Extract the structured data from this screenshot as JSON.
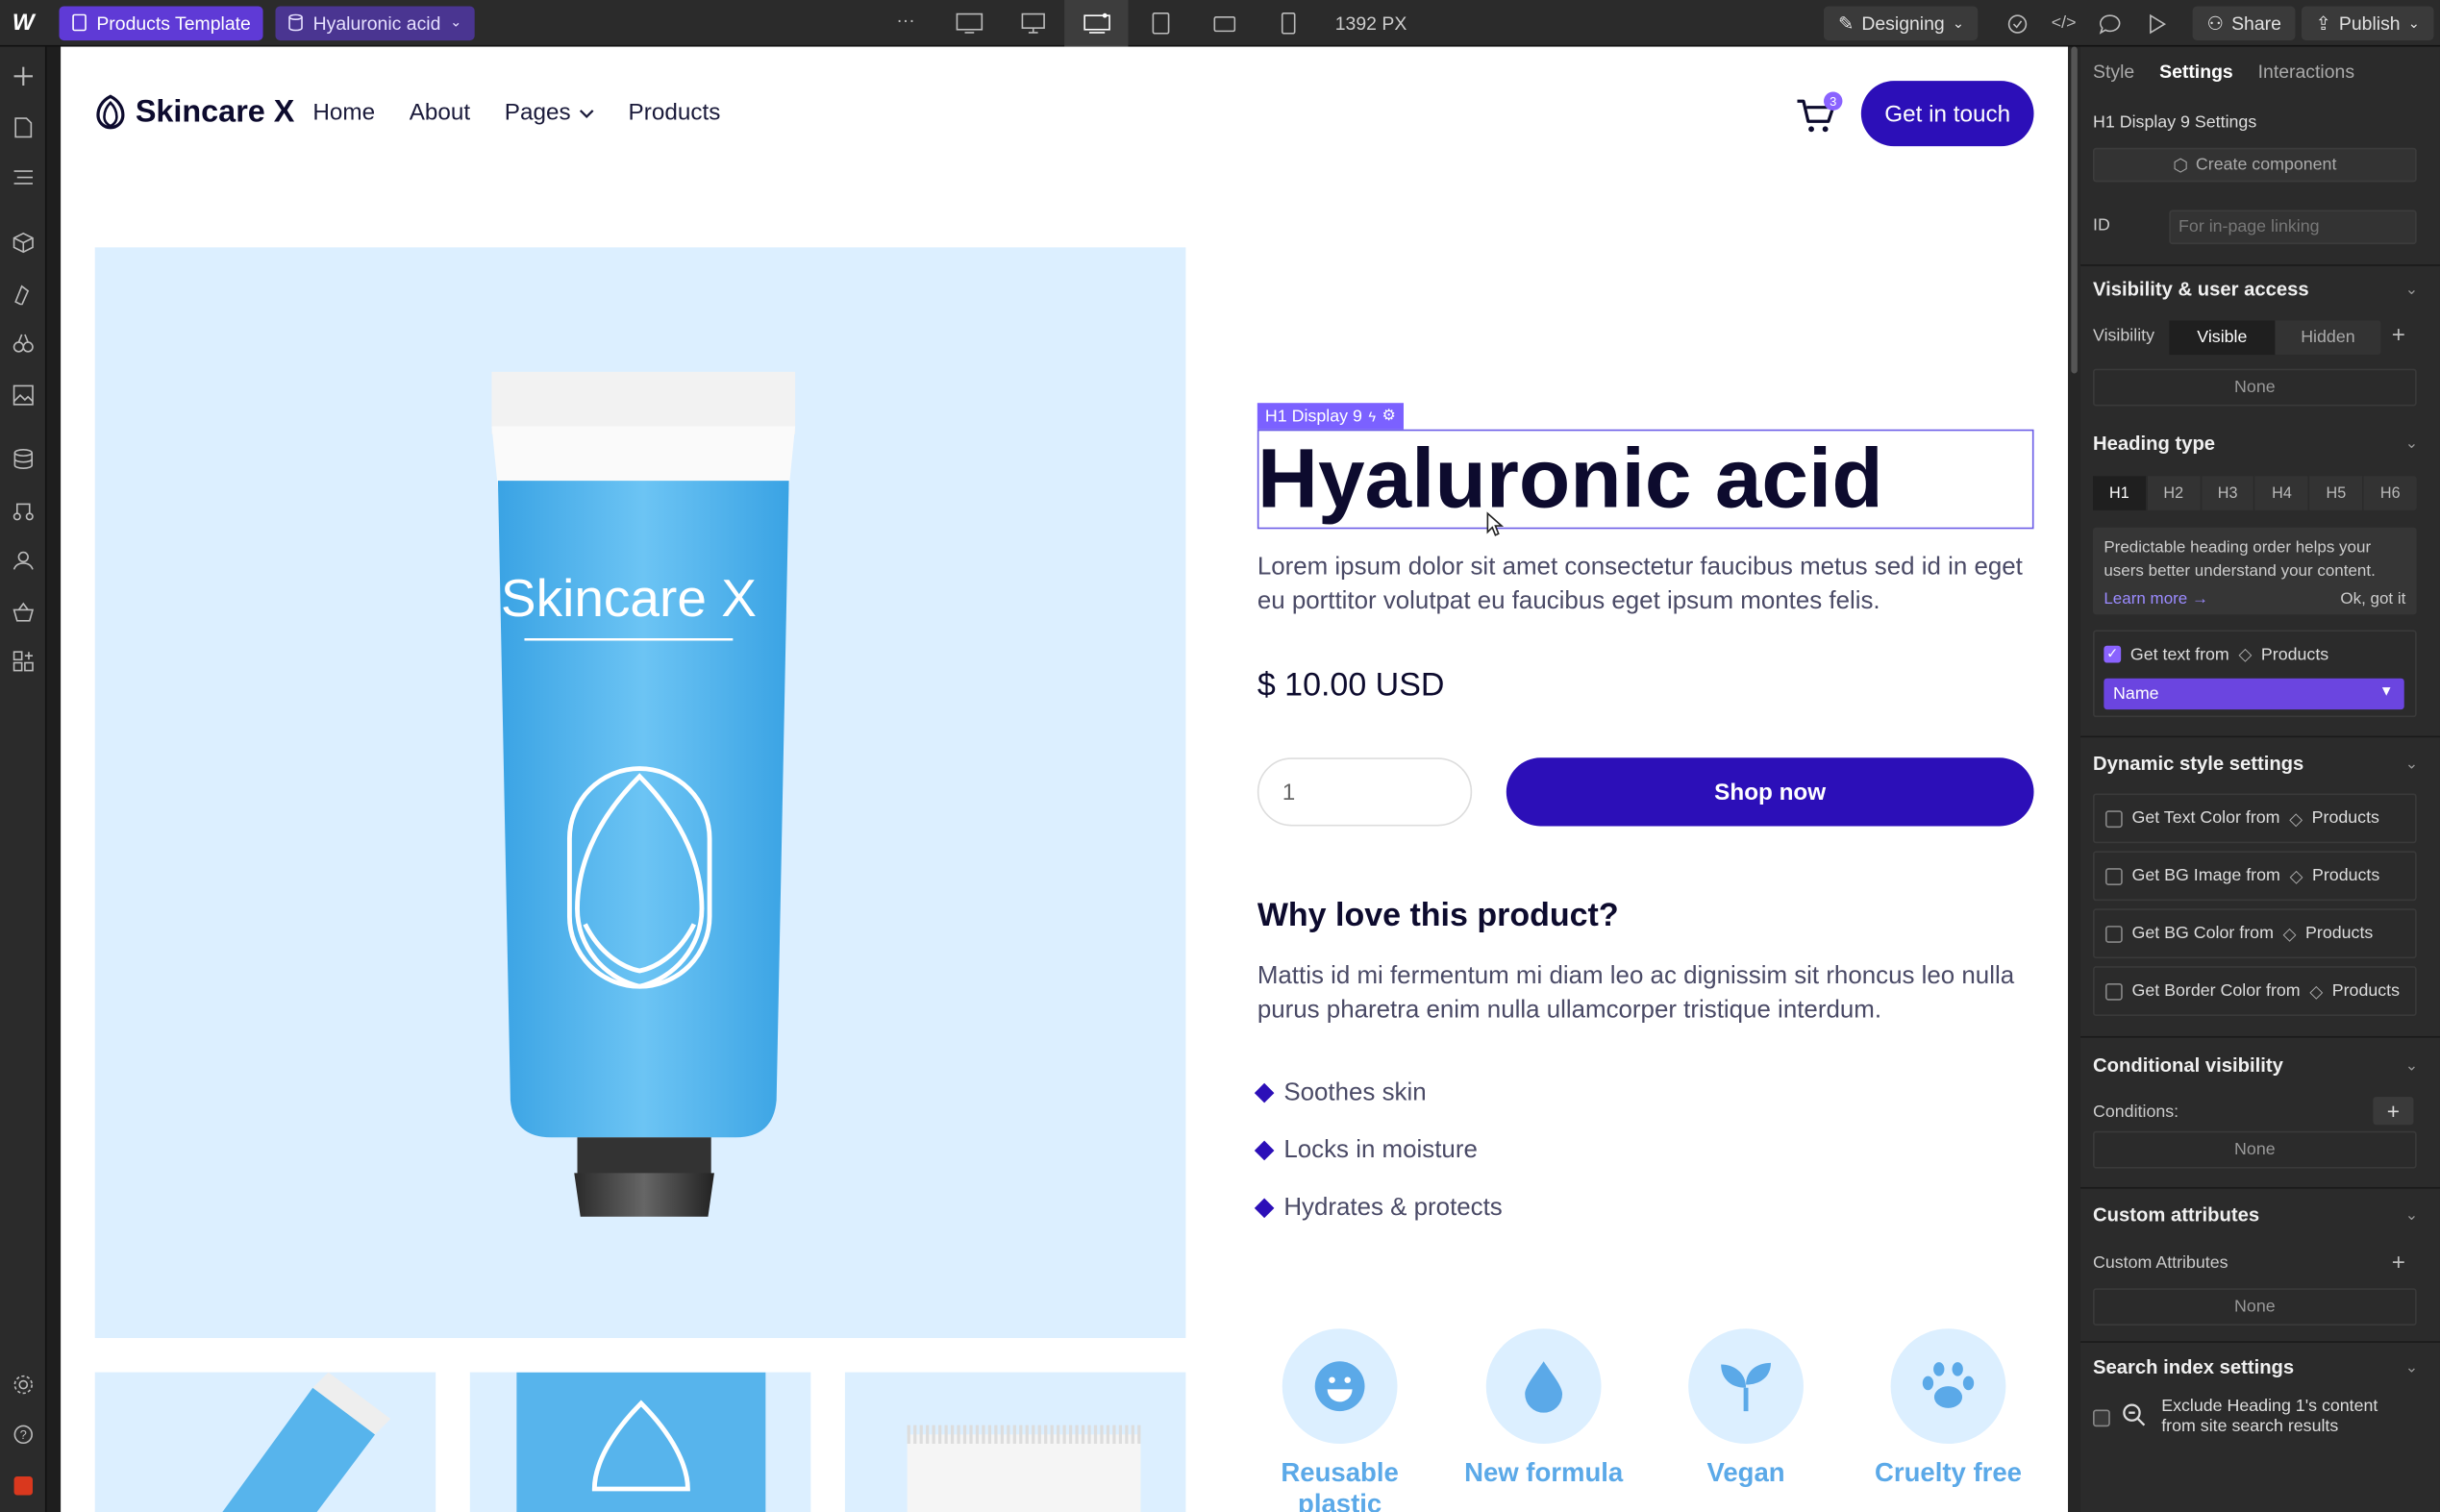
{
  "topbar": {
    "page_label": "Products Template",
    "cms_item": "Hyaluronic acid",
    "more": "···",
    "width_label": "1392 PX",
    "mode_label": "Designing",
    "share_label": "Share",
    "publish_label": "Publish"
  },
  "site": {
    "brand": "Skincare X",
    "nav": [
      "Home",
      "About",
      "Pages",
      "Products"
    ],
    "cart_count": "3",
    "cta": "Get in touch"
  },
  "product": {
    "tag": "H1 Display 9",
    "title": "Hyaluronic acid",
    "description": "Lorem ipsum dolor sit amet consectetur faucibus metus sed id in eget eu porttitor volutpat eu faucibus eget ipsum montes felis.",
    "price": "$ 10.00 USD",
    "qty": "1",
    "shop_label": "Shop now",
    "why_title": "Why love this product?",
    "why_desc": "Mattis id mi fermentum mi diam leo ac dignissim sit rhoncus leo nulla purus pharetra enim nulla ullamcorper tristique interdum.",
    "bullets": [
      "Soothes skin",
      "Locks in moisture",
      "Hydrates & protects"
    ],
    "tube_text": "Skincare X",
    "features": [
      "Reusable plastic",
      "New formula",
      "Vegan",
      "Cruelty free"
    ]
  },
  "panel": {
    "tabs": [
      "Style",
      "Settings",
      "Interactions"
    ],
    "element_settings": "H1 Display 9 Settings",
    "create_component": "Create component",
    "id_label": "ID",
    "id_placeholder": "For in-page linking",
    "visibility_section": "Visibility & user access",
    "visibility_label": "Visibility",
    "visible": "Visible",
    "hidden": "Hidden",
    "none": "None",
    "heading_section": "Heading type",
    "heading_options": [
      "H1",
      "H2",
      "H3",
      "H4",
      "H5",
      "H6"
    ],
    "heading_info": "Predictable heading order helps your users better understand your content.",
    "learn_more": "Learn more →",
    "ok_got_it": "Ok, got it",
    "get_text_from": "Get text from",
    "collection": "Products",
    "name_field": "Name",
    "dynamic_section": "Dynamic style settings",
    "dynamic_rows": [
      "Get Text Color from",
      "Get BG Image from",
      "Get BG Color from",
      "Get Border Color from"
    ],
    "conditional_section": "Conditional visibility",
    "conditions_label": "Conditions:",
    "custom_section": "Custom attributes",
    "custom_label": "Custom Attributes",
    "search_section": "Search index settings",
    "exclude_text": "Exclude Heading 1's content from site search results"
  },
  "colors": {
    "accent": "#2c0fb8",
    "panel_purple": "#5f3ad6",
    "hero_bg": "#dcefff",
    "feature_text": "#5ba9e8"
  }
}
